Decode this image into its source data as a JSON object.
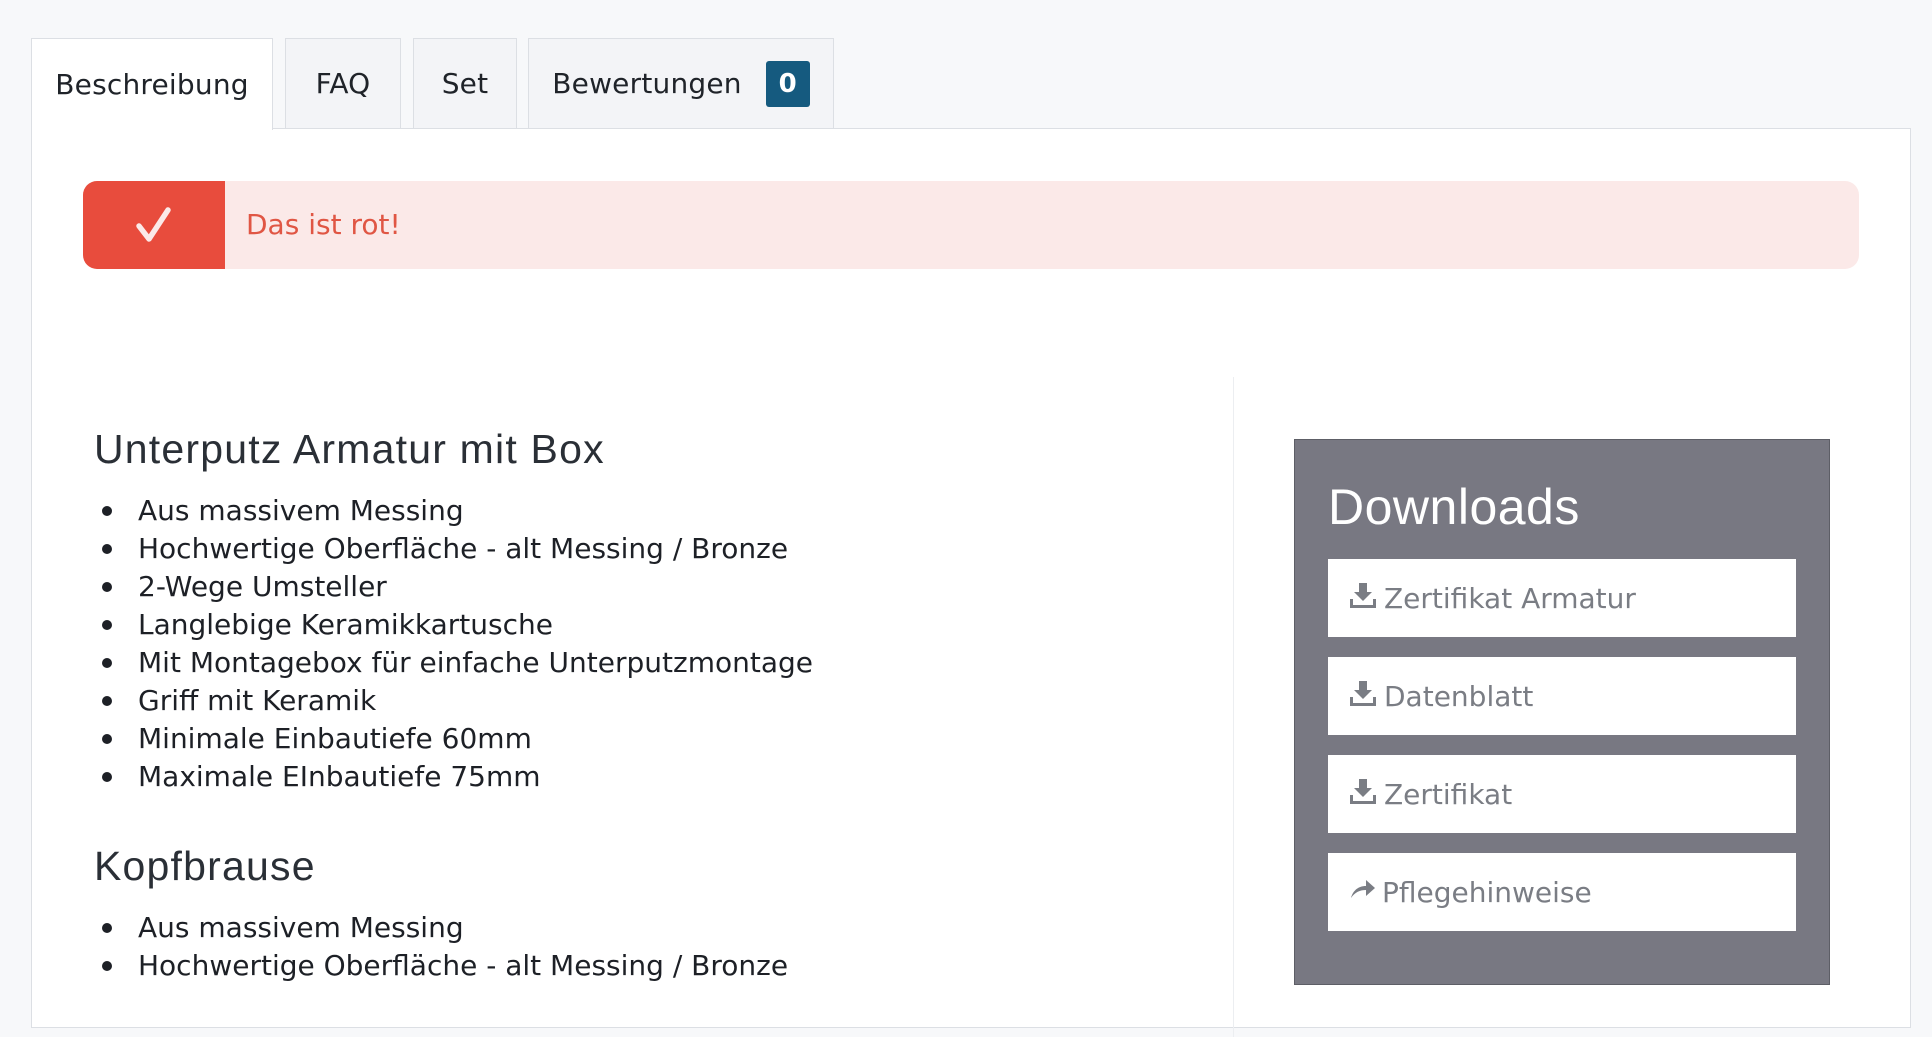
{
  "tabs": [
    {
      "label": "Beschreibung",
      "active": true
    },
    {
      "label": "FAQ"
    },
    {
      "label": "Set"
    },
    {
      "label": "Bewertungen",
      "badge": "0"
    }
  ],
  "alert": {
    "text": "Das ist rot!",
    "icon": "checkmark-icon",
    "color": "#e84c3d"
  },
  "sections": [
    {
      "title": "Unterputz Armatur mit Box",
      "items": [
        "Aus massivem Messing",
        "Hochwertige Oberfläche - alt Messing / Bronze",
        "2-Wege Umsteller",
        "Langlebige Keramikkartusche",
        "Mit Montagebox für einfache Unterputzmontage",
        "Griff mit Keramik",
        "Minimale Einbautiefe 60mm",
        "Maximale EInbautiefe 75mm"
      ]
    },
    {
      "title": "Kopfbrause",
      "items": [
        "Aus massivem Messing",
        "Hochwertige Oberfläche - alt Messing / Bronze"
      ]
    }
  ],
  "downloads": {
    "title": "Downloads",
    "items": [
      {
        "label": "Zertifikat Armatur",
        "icon": "download-icon"
      },
      {
        "label": "Datenblatt",
        "icon": "download-icon"
      },
      {
        "label": "Zertifikat",
        "icon": "download-icon"
      },
      {
        "label": "Pflegehinweise",
        "icon": "share-arrow-icon"
      }
    ]
  }
}
